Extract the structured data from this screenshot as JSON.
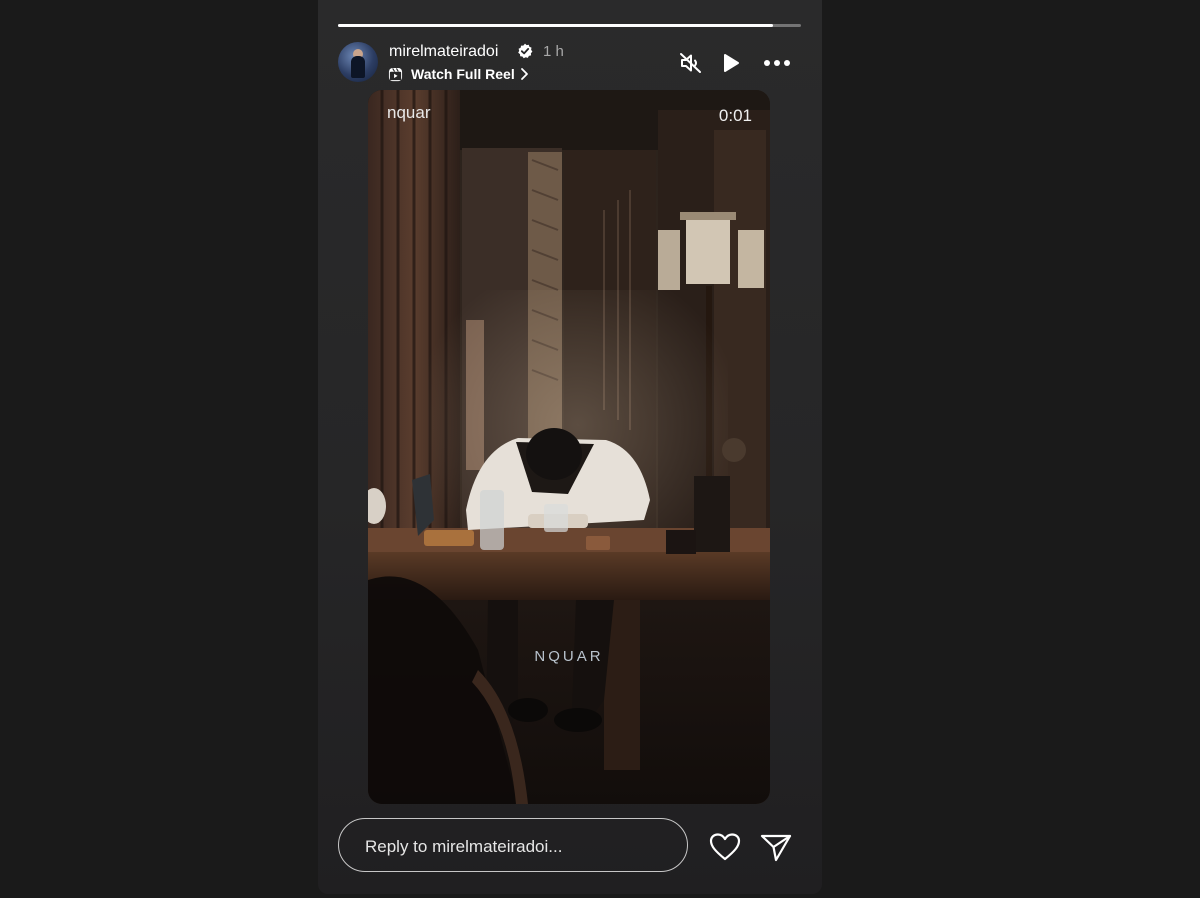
{
  "story": {
    "progress": 0.94,
    "username": "mirelmateiradoi",
    "verified": true,
    "time": "1 h",
    "watch_full_reel": "Watch Full Reel",
    "controls": {
      "mute_icon": "muted-speaker-icon",
      "play_icon": "play-icon",
      "more_icon": "more-options-icon"
    }
  },
  "video": {
    "overlay_user": "nquar",
    "overlay_time": "0:01",
    "watermark": "NQUAR"
  },
  "reply": {
    "placeholder": "Reply to mirelmateiradoi...",
    "like_icon": "heart-icon",
    "share_icon": "send-icon"
  },
  "colors": {
    "page_bg": "#1a1a1a",
    "story_bg": "#262627",
    "meta_text": "#a8a8a8"
  }
}
